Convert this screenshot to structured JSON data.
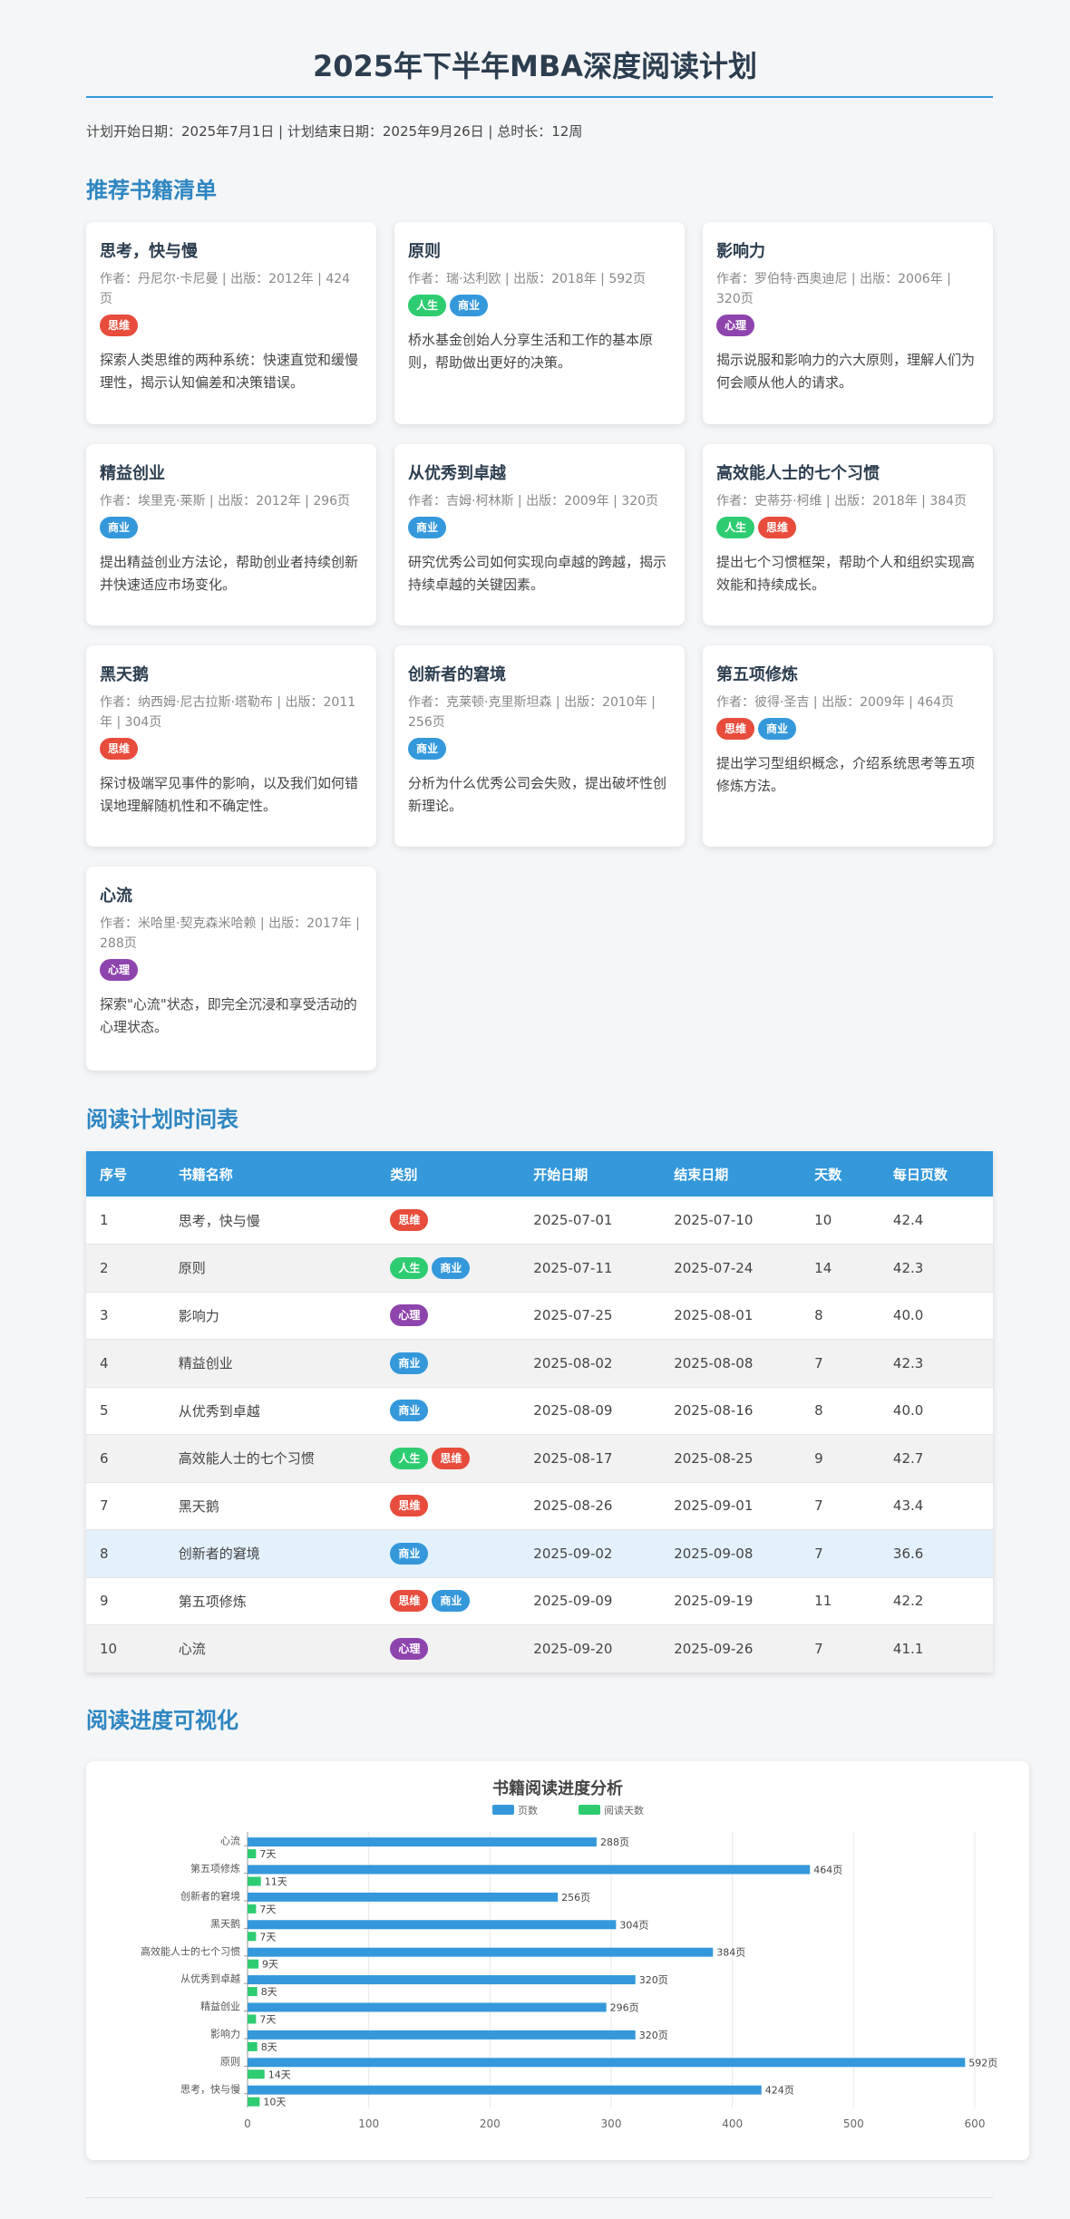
{
  "title": "2025年下半年MBA深度阅读计划",
  "meta": "计划开始日期：2025年7月1日 | 计划结束日期：2025年9月26日 | 总时长：12周",
  "sections": {
    "books": "推荐书籍清单",
    "schedule": "阅读计划时间表",
    "progress": "阅读进度可视化"
  },
  "tag_colors": {
    "思维": "#e74c3c",
    "人生": "#2ecc71",
    "商业": "#3498db",
    "心理": "#8e44ad"
  },
  "books": [
    {
      "title": "思考，快与慢",
      "meta": "作者：丹尼尔·卡尼曼 | 出版：2012年 | 424页",
      "tags": [
        "思维"
      ],
      "desc": "探索人类思维的两种系统：快速直觉和缓慢理性，揭示认知偏差和决策错误。"
    },
    {
      "title": "原则",
      "meta": "作者：瑞·达利欧 | 出版：2018年 | 592页",
      "tags": [
        "人生",
        "商业"
      ],
      "desc": "桥水基金创始人分享生活和工作的基本原则，帮助做出更好的决策。"
    },
    {
      "title": "影响力",
      "meta": "作者：罗伯特·西奥迪尼 | 出版：2006年 | 320页",
      "tags": [
        "心理"
      ],
      "desc": "揭示说服和影响力的六大原则，理解人们为何会顺从他人的请求。"
    },
    {
      "title": "精益创业",
      "meta": "作者：埃里克·莱斯 | 出版：2012年 | 296页",
      "tags": [
        "商业"
      ],
      "desc": "提出精益创业方法论，帮助创业者持续创新并快速适应市场变化。"
    },
    {
      "title": "从优秀到卓越",
      "meta": "作者：吉姆·柯林斯 | 出版：2009年 | 320页",
      "tags": [
        "商业"
      ],
      "desc": "研究优秀公司如何实现向卓越的跨越，揭示持续卓越的关键因素。"
    },
    {
      "title": "高效能人士的七个习惯",
      "meta": "作者：史蒂芬·柯维 | 出版：2018年 | 384页",
      "tags": [
        "人生",
        "思维"
      ],
      "desc": "提出七个习惯框架，帮助个人和组织实现高效能和持续成长。"
    },
    {
      "title": "黑天鹅",
      "meta": "作者：纳西姆·尼古拉斯·塔勒布 | 出版：2011年 | 304页",
      "tags": [
        "思维"
      ],
      "desc": "探讨极端罕见事件的影响，以及我们如何错误地理解随机性和不确定性。"
    },
    {
      "title": "创新者的窘境",
      "meta": "作者：克莱顿·克里斯坦森 | 出版：2010年 | 256页",
      "tags": [
        "商业"
      ],
      "desc": "分析为什么优秀公司会失败，提出破坏性创新理论。"
    },
    {
      "title": "第五项修炼",
      "meta": "作者：彼得·圣吉 | 出版：2009年 | 464页",
      "tags": [
        "思维",
        "商业"
      ],
      "desc": "提出学习型组织概念，介绍系统思考等五项修炼方法。"
    },
    {
      "title": "心流",
      "meta": "作者：米哈里·契克森米哈赖 | 出版：2017年 | 288页",
      "tags": [
        "心理"
      ],
      "desc": "探索\"心流\"状态，即完全沉浸和享受活动的心理状态。"
    }
  ],
  "table": {
    "headers": [
      "序号",
      "书籍名称",
      "类别",
      "开始日期",
      "结束日期",
      "天数",
      "每日页数"
    ],
    "rows": [
      {
        "no": "1",
        "name": "思考，快与慢",
        "tags": [
          "思维"
        ],
        "start": "2025-07-01",
        "end": "2025-07-10",
        "days": "10",
        "ppd": "42.4"
      },
      {
        "no": "2",
        "name": "原则",
        "tags": [
          "人生",
          "商业"
        ],
        "start": "2025-07-11",
        "end": "2025-07-24",
        "days": "14",
        "ppd": "42.3"
      },
      {
        "no": "3",
        "name": "影响力",
        "tags": [
          "心理"
        ],
        "start": "2025-07-25",
        "end": "2025-08-01",
        "days": "8",
        "ppd": "40.0"
      },
      {
        "no": "4",
        "name": "精益创业",
        "tags": [
          "商业"
        ],
        "start": "2025-08-02",
        "end": "2025-08-08",
        "days": "7",
        "ppd": "42.3"
      },
      {
        "no": "5",
        "name": "从优秀到卓越",
        "tags": [
          "商业"
        ],
        "start": "2025-08-09",
        "end": "2025-08-16",
        "days": "8",
        "ppd": "40.0"
      },
      {
        "no": "6",
        "name": "高效能人士的七个习惯",
        "tags": [
          "人生",
          "思维"
        ],
        "start": "2025-08-17",
        "end": "2025-08-25",
        "days": "9",
        "ppd": "42.7"
      },
      {
        "no": "7",
        "name": "黑天鹅",
        "tags": [
          "思维"
        ],
        "start": "2025-08-26",
        "end": "2025-09-01",
        "days": "7",
        "ppd": "43.4"
      },
      {
        "no": "8",
        "name": "创新者的窘境",
        "tags": [
          "商业"
        ],
        "start": "2025-09-02",
        "end": "2025-09-08",
        "days": "7",
        "ppd": "36.6",
        "highlight": true
      },
      {
        "no": "9",
        "name": "第五项修炼",
        "tags": [
          "思维",
          "商业"
        ],
        "start": "2025-09-09",
        "end": "2025-09-19",
        "days": "11",
        "ppd": "42.2"
      },
      {
        "no": "10",
        "name": "心流",
        "tags": [
          "心理"
        ],
        "start": "2025-09-20",
        "end": "2025-09-26",
        "days": "7",
        "ppd": "41.1"
      }
    ]
  },
  "chart_data": {
    "type": "bar",
    "orientation": "horizontal",
    "title": "书籍阅读进度分析",
    "categories": [
      "思考，快与慢",
      "原则",
      "影响力",
      "精益创业",
      "从优秀到卓越",
      "高效能人士的七个习惯",
      "黑天鹅",
      "创新者的窘境",
      "第五项修炼",
      "心流"
    ],
    "series": [
      {
        "name": "页数",
        "values": [
          424,
          592,
          320,
          296,
          320,
          384,
          304,
          256,
          464,
          288
        ],
        "label_suffix": "页",
        "color": "#3498db"
      },
      {
        "name": "阅读天数",
        "values": [
          10,
          14,
          8,
          7,
          8,
          9,
          7,
          7,
          11,
          7
        ],
        "label_suffix": "天",
        "color": "#2ecc71"
      }
    ],
    "xlim": [
      0,
      600
    ],
    "xticks": [
      0,
      100,
      200,
      300,
      400,
      500,
      600
    ],
    "grid": true,
    "legend": "top"
  }
}
